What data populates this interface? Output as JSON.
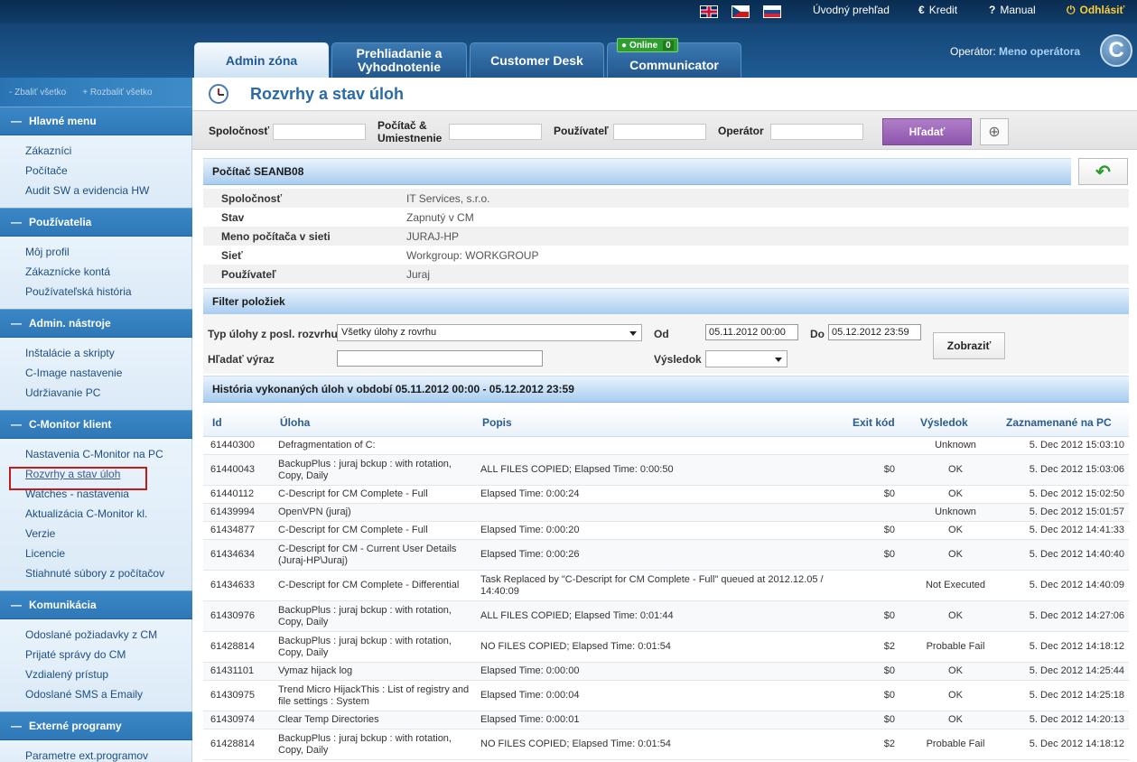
{
  "header": {
    "flags": [
      "uk-flag",
      "cz-flag",
      "sk-flag"
    ],
    "links": {
      "overview": "Úvodný prehľad",
      "credit": "Kredit",
      "manual": "Manual",
      "logout": "Odhlásiť"
    },
    "tabs": [
      {
        "label": "Admin zóna",
        "active": true
      },
      {
        "label": "Prehliadanie a Vyhodnotenie",
        "active": false
      },
      {
        "label": "Customer Desk",
        "active": false
      },
      {
        "label": "Communicator",
        "active": false
      }
    ],
    "online_label": "Online",
    "online_count": "0",
    "operator_label": "Operátor:",
    "operator_name": "Meno operátora",
    "logo_letter": "C"
  },
  "sidebar": {
    "collapse_all": "- Zbaliť všetko",
    "expand_all": "+ Rozbaliť všetko",
    "sections": [
      {
        "title": "Hlavné menu",
        "items": [
          "Zákazníci",
          "Počítače",
          "Audit SW a evidencia HW"
        ]
      },
      {
        "title": "Používatelia",
        "items": [
          "Môj profil",
          "Zákaznícke kontá",
          "Používateľská história"
        ]
      },
      {
        "title": "Admin. nástroje",
        "items": [
          "Inštalácie a skripty",
          "C-Image nastavenie",
          "Udržiavanie PC"
        ]
      },
      {
        "title": "C-Monitor klient",
        "items": [
          "Nastavenia C-Monitor na PC",
          "Rozvrhy a stav úloh",
          "Watches - nastavenia",
          "Aktualizácia C-Monitor kl.",
          "Verzie",
          "Licencie",
          "Stiahnuté súbory z počítačov"
        ]
      },
      {
        "title": "Komunikácia",
        "items": [
          "Odoslané požiadavky z CM",
          "Prijaté správy do CM",
          "Vzdialený prístup",
          "Odoslané SMS a Emaily"
        ]
      },
      {
        "title": "Externé programy",
        "items": [
          "Parametre ext.programov"
        ]
      }
    ],
    "current_item": "Rozvrhy a stav úloh"
  },
  "page": {
    "title": "Rozvrhy a stav úloh"
  },
  "search": {
    "company_label": "Spoločnosť",
    "computer_label_1": "Počítač &",
    "computer_label_2": "Umiestnenie",
    "user_label": "Používateľ",
    "operator_label": "Operátor",
    "search_button": "Hľadať"
  },
  "computer": {
    "header": "Počítač SEANB08",
    "rows": [
      {
        "key": "Spoločnosť",
        "value": "IT Services, s.r.o."
      },
      {
        "key": "Stav",
        "value": "Zapnutý v CM"
      },
      {
        "key": "Meno počítača v sieti",
        "value": "JURAJ-HP"
      },
      {
        "key": "Sieť",
        "value": "Workgroup: WORKGROUP"
      },
      {
        "key": "Používateľ",
        "value": "Juraj"
      }
    ]
  },
  "filter": {
    "header": "Filter položiek",
    "task_type_label": "Typ úlohy z posl. rozvrhu",
    "task_type_value": "Všetky úlohy z rovrhu",
    "search_label": "Hľadať výraz",
    "search_value": "",
    "from_label": "Od",
    "from_value": "05.11.2012 00:00",
    "to_label": "Do",
    "to_value": "05.12.2012 23:59",
    "result_label": "Výsledok",
    "result_value": "",
    "show_button": "Zobraziť"
  },
  "history": {
    "header": "História vykonaných úloh v období 05.11.2012 00:00 - 05.12.2012 23:59",
    "columns": [
      "Id",
      "Úloha",
      "Popis",
      "Exit kód",
      "Výsledok",
      "Zaznamenané na PC"
    ],
    "rows": [
      {
        "id": "61440300",
        "task": "Defragmentation of C:",
        "desc": "",
        "exit": "",
        "result": "Unknown",
        "date": "5. Dec 2012 15:03:10"
      },
      {
        "id": "61440043",
        "task": "BackupPlus : juraj bckup : with rotation, Copy, Daily",
        "desc": "ALL FILES COPIED; Elapsed Time: 0:00:50",
        "exit": "$0",
        "result": "OK",
        "date": "5. Dec 2012 15:03:06"
      },
      {
        "id": "61440112",
        "task": "C-Descript for CM Complete - Full",
        "desc": "Elapsed Time: 0:00:24",
        "exit": "$0",
        "result": "OK",
        "date": "5. Dec 2012 15:02:50"
      },
      {
        "id": "61439994",
        "task": "OpenVPN (juraj)",
        "desc": "",
        "exit": "",
        "result": "Unknown",
        "date": "5. Dec 2012 15:01:57"
      },
      {
        "id": "61434877",
        "task": "C-Descript for CM Complete - Full",
        "desc": "Elapsed Time: 0:00:20",
        "exit": "$0",
        "result": "OK",
        "date": "5. Dec 2012 14:41:33"
      },
      {
        "id": "61434634",
        "task": "C-Descript for CM - Current User Details (Juraj-HP\\Juraj)",
        "desc": "Elapsed Time: 0:00:26",
        "exit": "$0",
        "result": "OK",
        "date": "5. Dec 2012 14:40:40"
      },
      {
        "id": "61434633",
        "task": "C-Descript for CM Complete - Differential",
        "desc": "Task Replaced by \"C-Descript for CM Complete - Full\" queued at 2012.12.05 / 14:40:09",
        "exit": "",
        "result": "Not Executed",
        "date": "5. Dec 2012 14:40:09"
      },
      {
        "id": "61430976",
        "task": "BackupPlus : juraj bckup : with rotation, Copy, Daily",
        "desc": "ALL FILES COPIED; Elapsed Time: 0:01:44",
        "exit": "$0",
        "result": "OK",
        "date": "5. Dec 2012 14:27:06"
      },
      {
        "id": "61428814",
        "task": "BackupPlus : juraj bckup : with rotation, Copy, Daily",
        "desc": "NO FILES COPIED; Elapsed Time: 0:01:54",
        "exit": "$2",
        "result": "Probable Fail",
        "date": "5. Dec 2012 14:18:12"
      },
      {
        "id": "61431101",
        "task": "Vymaz hijack log",
        "desc": "Elapsed Time: 0:00:00",
        "exit": "$0",
        "result": "OK",
        "date": "5. Dec 2012 14:25:44"
      },
      {
        "id": "61430975",
        "task": "Trend Micro HijackThis : List of registry and file settings : System",
        "desc": "Elapsed Time: 0:00:04",
        "exit": "$0",
        "result": "OK",
        "date": "5. Dec 2012 14:25:18"
      },
      {
        "id": "61430974",
        "task": "Clear Temp Directories",
        "desc": "Elapsed Time: 0:00:01",
        "exit": "$0",
        "result": "OK",
        "date": "5. Dec 2012 14:20:13"
      },
      {
        "id": "61428814",
        "task": "BackupPlus : juraj bckup : with rotation, Copy, Daily",
        "desc": "NO FILES COPIED; Elapsed Time: 0:01:54",
        "exit": "$2",
        "result": "Probable Fail",
        "date": "5. Dec 2012 14:18:12"
      }
    ]
  }
}
